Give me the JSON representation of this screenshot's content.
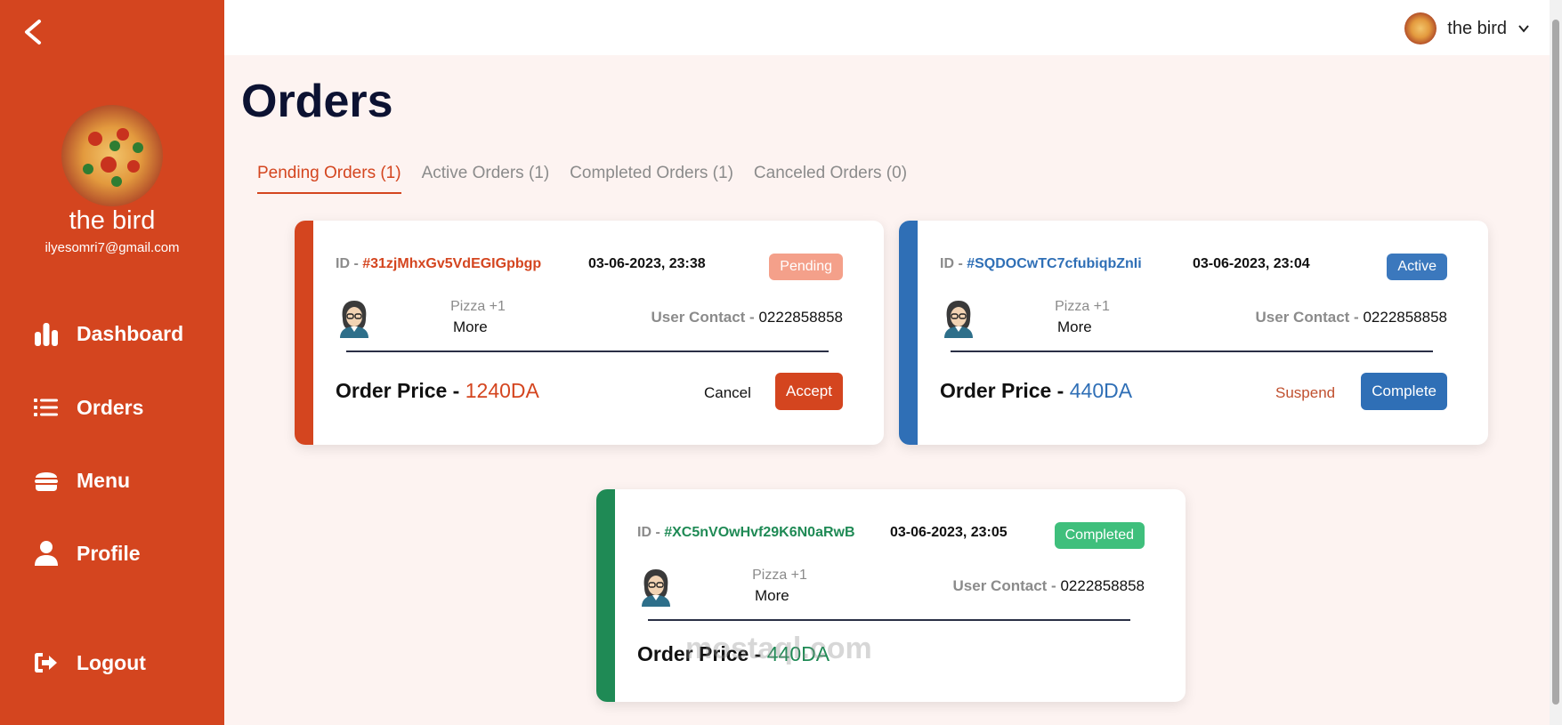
{
  "user": {
    "name": "the bird",
    "email": "ilyesomri7@gmail.com"
  },
  "sidebar": {
    "items": [
      {
        "label": "Dashboard",
        "icon": "chart-bar-icon"
      },
      {
        "label": "Orders",
        "icon": "list-icon"
      },
      {
        "label": "Menu",
        "icon": "burger-icon"
      },
      {
        "label": "Profile",
        "icon": "user-icon"
      }
    ],
    "logout_label": "Logout"
  },
  "page": {
    "title": "Orders"
  },
  "tabs": [
    {
      "label": "Pending Orders (1)",
      "active": true
    },
    {
      "label": "Active Orders (1)",
      "active": false
    },
    {
      "label": "Completed Orders (1)",
      "active": false
    },
    {
      "label": "Canceled Orders (0)",
      "active": false
    }
  ],
  "orders": [
    {
      "id_label": "ID -",
      "id": "#31zjMhxGv5VdEGIGpbgp",
      "date": "03-06-2023, 23:38",
      "status": "Pending",
      "items": "Pizza +1",
      "more": "More",
      "contact_label": "User Contact -",
      "contact": "0222858858",
      "price_label": "Order Price -",
      "price": "1240DA",
      "secondary_action": "Cancel",
      "primary_action": "Accept",
      "accent": "#d4451f",
      "badge_color": "#f4a08a"
    },
    {
      "id_label": "ID -",
      "id": "#SQDOCwTC7cfubiqbZnIi",
      "date": "03-06-2023, 23:04",
      "status": "Active",
      "items": "Pizza +1",
      "more": "More",
      "contact_label": "User Contact -",
      "contact": "0222858858",
      "price_label": "Order Price -",
      "price": "440DA",
      "secondary_action": "Suspend",
      "primary_action": "Complete",
      "accent": "#2f6fb6",
      "badge_color": "#3b78bd"
    },
    {
      "id_label": "ID -",
      "id": "#XC5nVOwHvf29K6N0aRwB",
      "date": "03-06-2023, 23:05",
      "status": "Completed",
      "items": "Pizza +1",
      "more": "More",
      "contact_label": "User Contact -",
      "contact": "0222858858",
      "price_label": "Order Price -",
      "price": "440DA",
      "accent": "#1f8a55",
      "badge_color": "#3fbf7c"
    }
  ],
  "watermark": "mostaql.com"
}
